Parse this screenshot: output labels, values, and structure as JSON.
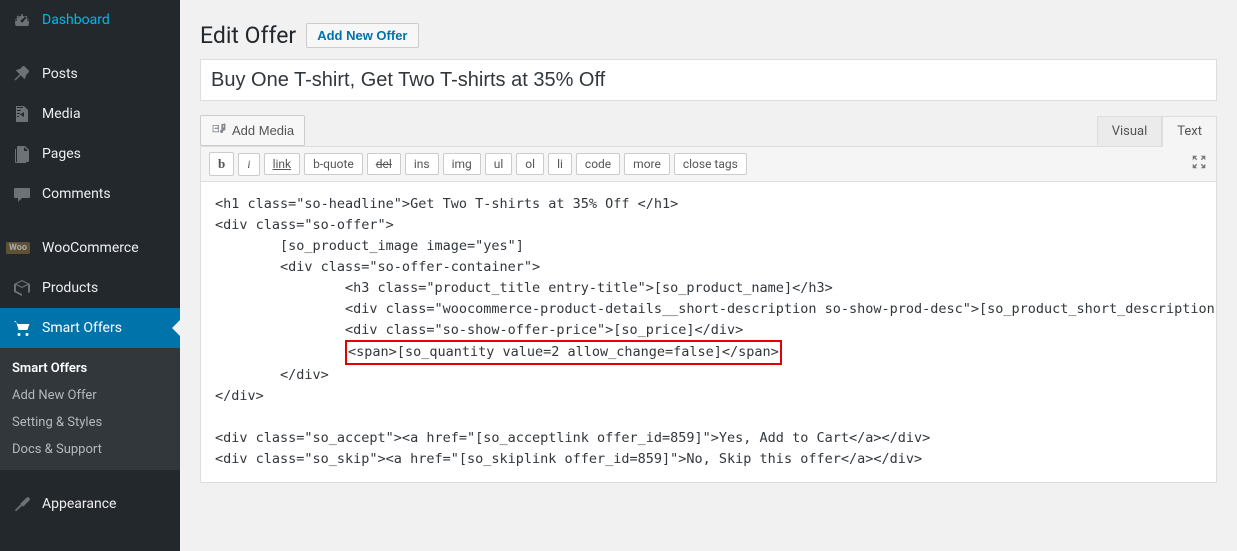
{
  "sidebar": {
    "items": [
      {
        "label": "Dashboard"
      },
      {
        "label": "Posts"
      },
      {
        "label": "Media"
      },
      {
        "label": "Pages"
      },
      {
        "label": "Comments"
      },
      {
        "label": "WooCommerce"
      },
      {
        "label": "Products"
      },
      {
        "label": "Smart Offers"
      },
      {
        "label": "Appearance"
      }
    ],
    "submenu": [
      {
        "label": "Smart Offers"
      },
      {
        "label": "Add New Offer"
      },
      {
        "label": "Setting & Styles"
      },
      {
        "label": "Docs & Support"
      }
    ]
  },
  "header": {
    "title": "Edit Offer",
    "add_new_label": "Add New Offer"
  },
  "post": {
    "title": "Buy One T-shirt, Get Two T-shirts at 35% Off"
  },
  "editor": {
    "add_media_label": "Add Media",
    "tabs": {
      "visual": "Visual",
      "text": "Text"
    },
    "quicktags": [
      "b",
      "i",
      "link",
      "b-quote",
      "del",
      "ins",
      "img",
      "ul",
      "ol",
      "li",
      "code",
      "more",
      "close tags"
    ],
    "content": {
      "l1": "<h1 class=\"so-headline\">Get Two T-shirts at 35% Off </h1>",
      "l2": "<div class=\"so-offer\">",
      "l3": "        [so_product_image image=\"yes\"]",
      "l4": "        <div class=\"so-offer-container\">",
      "l5": "                <h3 class=\"product_title entry-title\">[so_product_name]</h3>",
      "l6": "                <div class=\"woocommerce-product-details__short-description so-show-prod-desc\">[so_product_short_description]</div>",
      "l7": "                <div class=\"so-show-offer-price\">[so_price]</div>",
      "l8a": "                ",
      "l8b": "<span>[so_quantity value=2 allow_change=false]</span>",
      "l9": "        </div>",
      "l10": "</div>",
      "l11": "",
      "l12": "<div class=\"so_accept\"><a href=\"[so_acceptlink offer_id=859]\">Yes, Add to Cart</a></div>",
      "l13": "<div class=\"so_skip\"><a href=\"[so_skiplink offer_id=859]\">No, Skip this offer</a></div>"
    }
  }
}
